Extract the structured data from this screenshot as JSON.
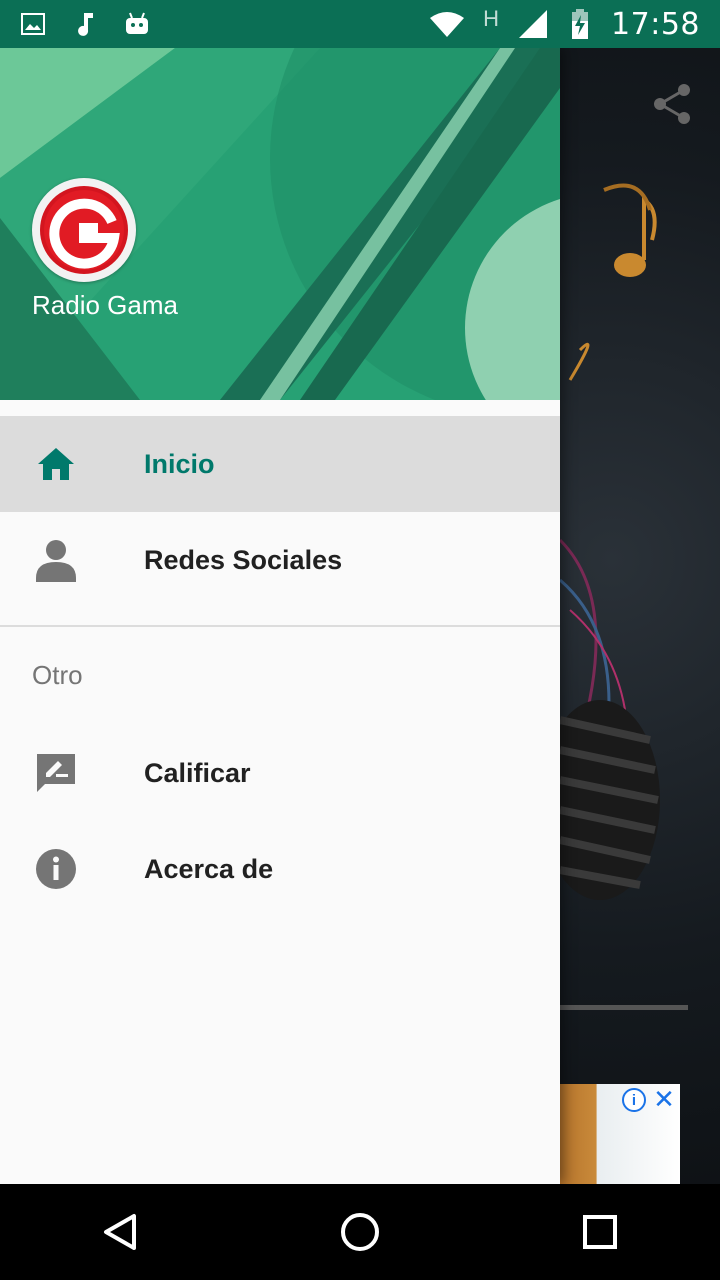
{
  "status_bar": {
    "time": "17:58",
    "network_type": "H",
    "icons": [
      "image-icon",
      "music-note-icon",
      "android-icon",
      "wifi-icon",
      "cell-signal-icon",
      "battery-charging-icon"
    ]
  },
  "drawer": {
    "header": {
      "app_name": "Radio Gama",
      "logo_letter": "G"
    },
    "items": [
      {
        "label": "Inicio",
        "icon": "home-icon",
        "active": true
      },
      {
        "label": "Redes Sociales",
        "icon": "person-icon",
        "active": false
      }
    ],
    "section_other": {
      "title": "Otro",
      "items": [
        {
          "label": "Calificar",
          "icon": "rate-review-icon"
        },
        {
          "label": "Acerca de",
          "icon": "info-icon"
        }
      ]
    }
  },
  "background_app": {
    "share_icon": "share-icon"
  },
  "ad": {
    "info_icon": "i",
    "close_icon": "✕"
  },
  "colors": {
    "status_bar": "#0b6f55",
    "accent": "#00796b",
    "active_item_bg": "#dcdcdc",
    "logo_red": "#d3151f"
  }
}
